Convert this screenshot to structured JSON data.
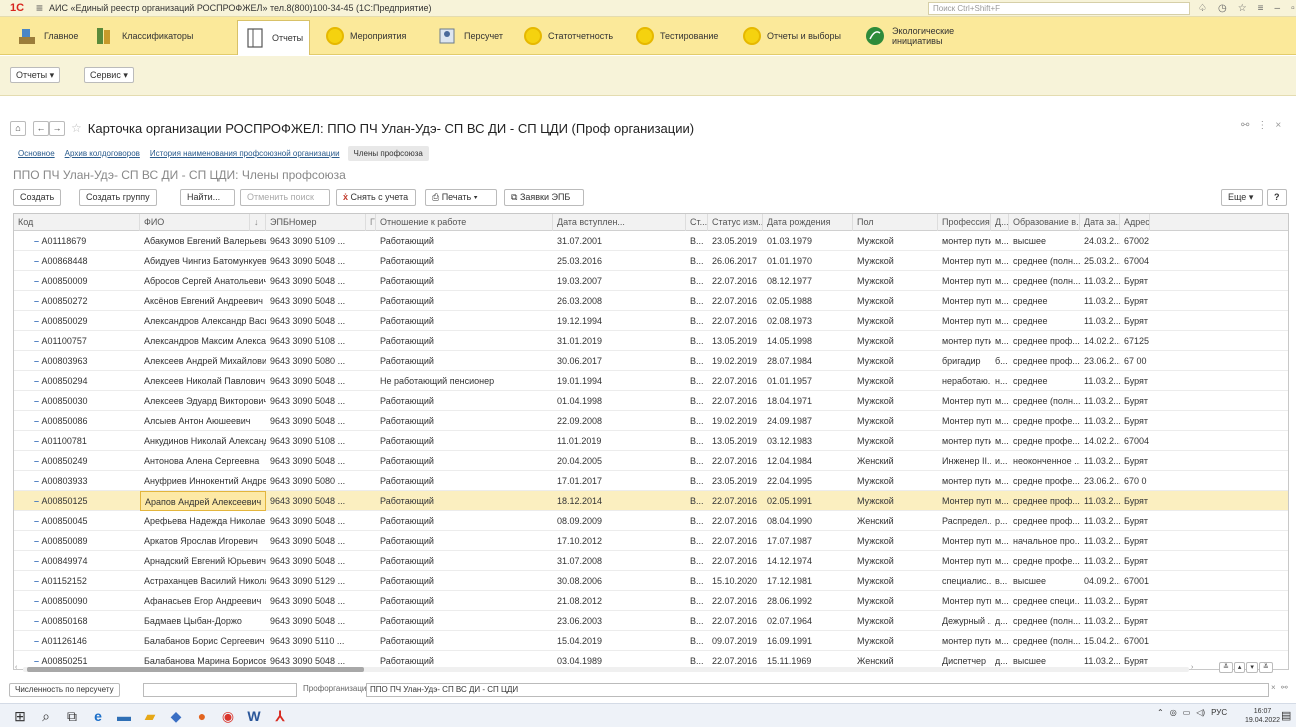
{
  "titlebar": {
    "logo": "1С",
    "title": "АИС «Единый реестр организаций РОСПРОФЖЕЛ» тел.8(800)100-34-45 (1С:Предприятие)",
    "search_placeholder": "Поиск Ctrl+Shift+F"
  },
  "sections": [
    {
      "label": "Главное"
    },
    {
      "label": "Классификаторы"
    },
    {
      "label": "Отчеты"
    },
    {
      "label": "Мероприятия"
    },
    {
      "label": "Персучет"
    },
    {
      "label": "Статотчетность"
    },
    {
      "label": "Тестирование"
    },
    {
      "label": "Отчеты и выборы"
    },
    {
      "label": "Экологические инициативы"
    }
  ],
  "commands": {
    "reports": "Отчеты ▾",
    "service": "Сервис ▾"
  },
  "form": {
    "title": "Карточка организации РОСПРОФЖЕЛ: ППО ПЧ Улан-Удэ- СП ВС ДИ - СП ЦДИ (Проф организации)"
  },
  "tabs": [
    {
      "label": "Основное"
    },
    {
      "label": "Архив колдоговоров"
    },
    {
      "label": "История наименования профсоюзной организации"
    },
    {
      "label": "Члены профсоюза"
    }
  ],
  "list_title": "ППО ПЧ Улан-Удэ- СП ВС ДИ - СП ЦДИ: Члены профсоюза",
  "toolbar": {
    "create": "Создать",
    "create_group": "Создать группу",
    "find": "Найти...",
    "cancel_search": "Отменить поиск",
    "deregister": "Снять с учета",
    "print": "Печать",
    "requests": "Заявки ЭПБ",
    "more": "Еще",
    "help": "?"
  },
  "columns": [
    "Код",
    "ФИО",
    "ЭПБНомер",
    "Отношение к работе",
    "Дата вступлен...",
    "Ст...",
    "Статус изм...",
    "Дата рождения",
    "Пол",
    "Профессия",
    "Д...",
    "Образование в...",
    "Дата за...",
    "Адрес"
  ],
  "rows": [
    [
      "A01118679",
      "Абакумов Евгений Валерьевич",
      "9643 3090 5109 ...",
      "Работающий",
      "31.07.2001",
      "В...",
      "23.05.2019",
      "01.03.1979",
      "Мужской",
      "монтер пути",
      "м...",
      "высшее",
      "24.03.2...",
      "67002"
    ],
    [
      "A00868448",
      "Абидуев Чингиз Батомункуевич",
      "9643 3090 5048 ...",
      "Работающий",
      "25.03.2016",
      "В...",
      "26.06.2017",
      "01.01.1970",
      "Мужской",
      "Монтер пути",
      "м...",
      "среднее (полн...",
      "25.03.2...",
      "67004"
    ],
    [
      "A00850009",
      "Абросов Сергей Анатольевич",
      "9643 3090 5048 ...",
      "Работающий",
      "19.03.2007",
      "В...",
      "22.07.2016",
      "08.12.1977",
      "Мужской",
      "Монтер пути",
      "м...",
      "среднее (полн...",
      "11.03.2...",
      "Бурят"
    ],
    [
      "A00850272",
      "Аксёнов Евгений Андреевич",
      "9643 3090 5048 ...",
      "Работающий",
      "26.03.2008",
      "В...",
      "22.07.2016",
      "02.05.1988",
      "Мужской",
      "Монтер пути",
      "м...",
      "среднее",
      "11.03.2...",
      "Бурят"
    ],
    [
      "A00850029",
      "Александров Александр Васильевич",
      "9643 3090 5048 ...",
      "Работающий",
      "19.12.1994",
      "В...",
      "22.07.2016",
      "02.08.1973",
      "Мужской",
      "Монтер пути",
      "м...",
      "среднее",
      "11.03.2...",
      "Бурят"
    ],
    [
      "A01100757",
      "Александров Максим Александрович",
      "9643 3090 5108 ...",
      "Работающий",
      "31.01.2019",
      "В...",
      "13.05.2019",
      "14.05.1998",
      "Мужской",
      "монтер пути",
      "м...",
      "среднее проф...",
      "14.02.2...",
      "67125"
    ],
    [
      "A00803963",
      "Алексеев Андрей Михайлович",
      "9643 3090 5080 ...",
      "Работающий",
      "30.06.2017",
      "В...",
      "19.02.2019",
      "28.07.1984",
      "Мужской",
      "бригадир",
      "б...",
      "среднее проф...",
      "23.06.2...",
      "67 00"
    ],
    [
      "A00850294",
      "Алексеев Николай Павлович",
      "9643 3090 5048 ...",
      "Не работающий пенсионер",
      "19.01.1994",
      "В...",
      "22.07.2016",
      "01.01.1957",
      "Мужской",
      "неработаю...",
      "н...",
      "среднее",
      "11.03.2...",
      "Бурят"
    ],
    [
      "A00850030",
      "Алексеев Эдуард Викторович",
      "9643 3090 5048 ...",
      "Работающий",
      "01.04.1998",
      "В...",
      "22.07.2016",
      "18.04.1971",
      "Мужской",
      "Монтер пути",
      "м...",
      "среднее (полн...",
      "11.03.2...",
      "Бурят"
    ],
    [
      "A00850086",
      "Алсыев Антон Аюшеевич",
      "9643 3090 5048 ...",
      "Работающий",
      "22.09.2008",
      "В...",
      "19.02.2019",
      "24.09.1987",
      "Мужской",
      "Монтер пути",
      "м...",
      "средне профе...",
      "11.03.2...",
      "Бурят"
    ],
    [
      "A01100781",
      "Анкудинов Николай Александрович",
      "9643 3090 5108 ...",
      "Работающий",
      "11.01.2019",
      "В...",
      "13.05.2019",
      "03.12.1983",
      "Мужской",
      "монтер пути",
      "м...",
      "средне профе...",
      "14.02.2...",
      "67004"
    ],
    [
      "A00850249",
      "Антонова Алена Сергеевна",
      "9643 3090 5048 ...",
      "Работающий",
      "20.04.2005",
      "В...",
      "22.07.2016",
      "12.04.1984",
      "Женский",
      "Инженер II...",
      "и...",
      "неоконченное ...",
      "11.03.2...",
      "Бурят"
    ],
    [
      "A00803933",
      "Ануфриев Иннокентий Андреевич",
      "9643 3090 5080 ...",
      "Работающий",
      "17.01.2017",
      "В...",
      "23.05.2019",
      "22.04.1995",
      "Мужской",
      "монтер пути",
      "м...",
      "средне профе...",
      "23.06.2...",
      "670 0"
    ],
    [
      "A00850125",
      "Арапов Андрей Алексеевич",
      "9643 3090 5048 ...",
      "Работающий",
      "18.12.2014",
      "В...",
      "22.07.2016",
      "02.05.1991",
      "Мужской",
      "Монтер пути",
      "м...",
      "среднее проф...",
      "11.03.2...",
      "Бурят"
    ],
    [
      "A00850045",
      "Арефьева Надежда Николаевна",
      "9643 3090 5048 ...",
      "Работающий",
      "08.09.2009",
      "В...",
      "22.07.2016",
      "08.04.1990",
      "Женский",
      "Распредел...",
      "р...",
      "среднее проф...",
      "11.03.2...",
      "Бурят"
    ],
    [
      "A00850089",
      "Аркатов Ярослав Игоревич",
      "9643 3090 5048 ...",
      "Работающий",
      "17.10.2012",
      "В...",
      "22.07.2016",
      "17.07.1987",
      "Мужской",
      "Монтер пути",
      "м...",
      "начальное про...",
      "11.03.2...",
      "Бурят"
    ],
    [
      "A00849974",
      "Арнадский Евгений Юрьевич",
      "9643 3090 5048 ...",
      "Работающий",
      "31.07.2008",
      "В...",
      "22.07.2016",
      "14.12.1974",
      "Мужской",
      "Монтер пути",
      "м...",
      "средне профе...",
      "11.03.2...",
      "Бурят"
    ],
    [
      "A01152152",
      "Астраханцев Василий Николаевич",
      "9643 3090 5129 ...",
      "Работающий",
      "30.08.2006",
      "В...",
      "15.10.2020",
      "17.12.1981",
      "Мужской",
      "специалис...",
      "в...",
      "высшее",
      "04.09.2...",
      "67001"
    ],
    [
      "A00850090",
      "Афанасьев Егор Андреевич",
      "9643 3090 5048 ...",
      "Работающий",
      "21.08.2012",
      "В...",
      "22.07.2016",
      "28.06.1992",
      "Мужской",
      "Монтер пути",
      "м...",
      "среднее специ...",
      "11.03.2...",
      "Бурят"
    ],
    [
      "A00850168",
      "Бадмаев Цыбан-Доржо",
      "9643 3090 5048 ...",
      "Работающий",
      "23.06.2003",
      "В...",
      "22.07.2016",
      "02.07.1964",
      "Мужской",
      "Дежурный ...",
      "д...",
      "среднее (полн...",
      "11.03.2...",
      "Бурят"
    ],
    [
      "A01126146",
      "Балабанов Борис Сергеевич",
      "9643 3090 5110 ...",
      "Работающий",
      "15.04.2019",
      "В...",
      "09.07.2019",
      "16.09.1991",
      "Мужской",
      "монтер пути",
      "м...",
      "среднее (полн...",
      "15.04.2...",
      "67001"
    ],
    [
      "A00850251",
      "Балабанова Марина Борисовна",
      "9643 3090 5048 ...",
      "Работающий",
      "03.04.1989",
      "В...",
      "22.07.2016",
      "15.11.1969",
      "Женский",
      "Диспетчер",
      "д...",
      "высшее",
      "11.03.2...",
      "Бурят"
    ]
  ],
  "selected_row": 13,
  "footer": {
    "count_button": "Численность по персучету",
    "org_label": "Профорганизация:",
    "org_value": "ППО ПЧ Улан-Удэ- СП ВС ДИ - СП ЦДИ"
  },
  "tray": {
    "lang": "РУС",
    "time": "16:07",
    "date": "19.04.2022"
  }
}
